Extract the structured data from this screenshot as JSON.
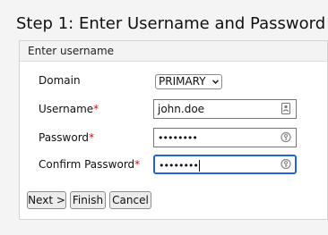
{
  "page": {
    "title": "Step 1: Enter Username and Password"
  },
  "panel": {
    "header": "Enter username"
  },
  "form": {
    "domain": {
      "label": "Domain",
      "selected": "PRIMARY"
    },
    "username": {
      "label": "Username",
      "required_mark": "*",
      "value": "john.doe"
    },
    "password": {
      "label": "Password",
      "required_mark": "*",
      "masked_value": "••••••••"
    },
    "confirm": {
      "label": "Confirm Password",
      "required_mark": "*",
      "masked_value": "••••••••"
    }
  },
  "buttons": {
    "next": "Next >",
    "finish": "Finish",
    "cancel": "Cancel"
  },
  "colors": {
    "required": "#cc1111",
    "focus": "#2463d6"
  },
  "icons": {
    "username_field": "contact-card-icon",
    "password_field": "key-icon",
    "select": "chevron-down-icon"
  }
}
